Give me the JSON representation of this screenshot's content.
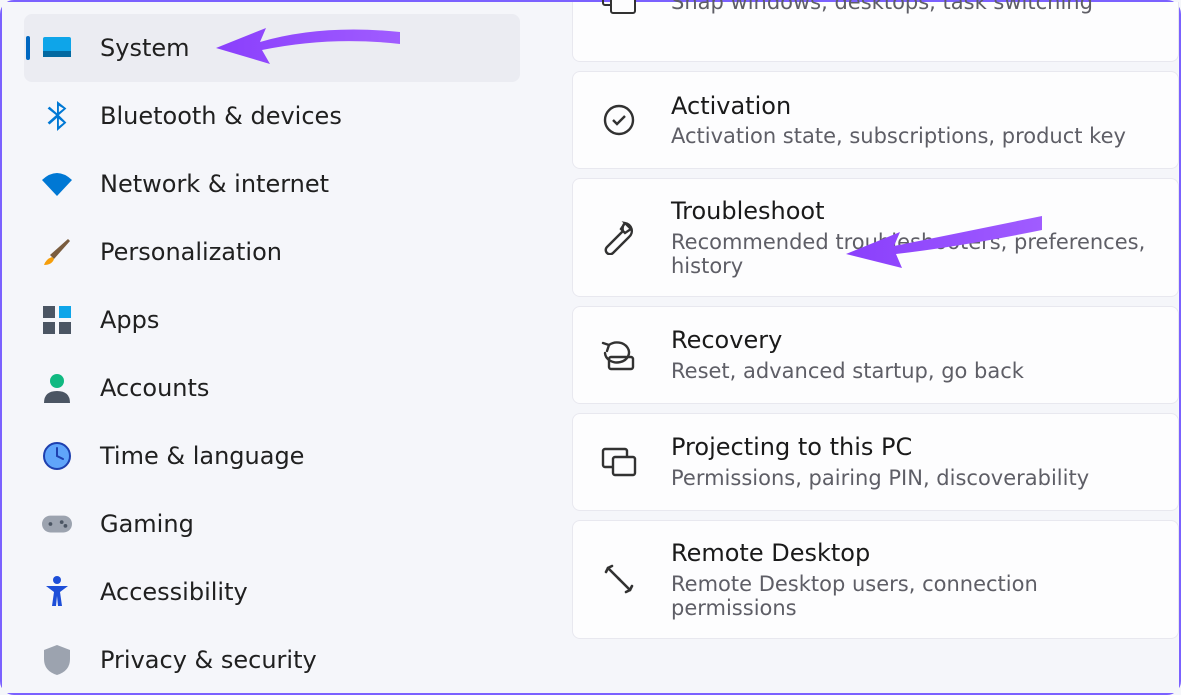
{
  "sidebar": {
    "items": [
      {
        "label": "System",
        "icon": "system-icon",
        "selected": true
      },
      {
        "label": "Bluetooth & devices",
        "icon": "bluetooth-icon"
      },
      {
        "label": "Network & internet",
        "icon": "wifi-icon"
      },
      {
        "label": "Personalization",
        "icon": "paintbrush-icon"
      },
      {
        "label": "Apps",
        "icon": "apps-icon"
      },
      {
        "label": "Accounts",
        "icon": "person-icon"
      },
      {
        "label": "Time & language",
        "icon": "clock-globe-icon"
      },
      {
        "label": "Gaming",
        "icon": "gamepad-icon"
      },
      {
        "label": "Accessibility",
        "icon": "accessibility-icon"
      },
      {
        "label": "Privacy & security",
        "icon": "shield-icon"
      }
    ]
  },
  "content": {
    "items": [
      {
        "title": "",
        "sub": "Snap windows, desktops, task switching",
        "icon": "multitask-icon"
      },
      {
        "title": "Activation",
        "sub": "Activation state, subscriptions, product key",
        "icon": "check-circle-icon"
      },
      {
        "title": "Troubleshoot",
        "sub": "Recommended troubleshooters, preferences, history",
        "icon": "wrench-icon"
      },
      {
        "title": "Recovery",
        "sub": "Reset, advanced startup, go back",
        "icon": "recovery-icon"
      },
      {
        "title": "Projecting to this PC",
        "sub": "Permissions, pairing PIN, discoverability",
        "icon": "project-icon"
      },
      {
        "title": "Remote Desktop",
        "sub": "Remote Desktop users, connection permissions",
        "icon": "remote-icon"
      }
    ]
  },
  "annotations": {
    "arrow_color": "#8a3ffc"
  }
}
